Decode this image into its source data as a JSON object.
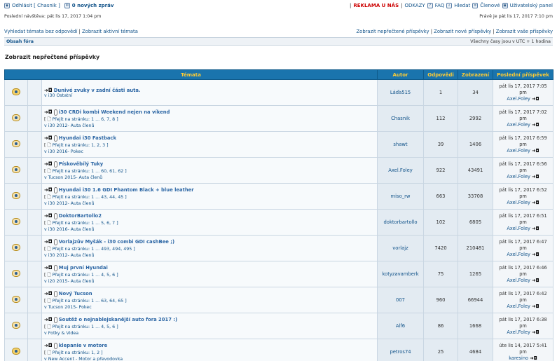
{
  "header": {
    "logout_label": "Odhlásit [ Chasnik ]",
    "messages_label": "0 nových zpráv",
    "reklama_label": "REKLAMA U NÁS",
    "sep": "|",
    "sep2": "|",
    "odkazy_label": "ODKAZY",
    "faq_label": "FAQ",
    "search_label": "Hledat",
    "members_label": "Členové",
    "panel_label": "Uživatelský panel",
    "last_visit": "Poslední návštěva: pát lis 17, 2017 1:04 pm",
    "now": "Právě je pát lis 17, 2017 7:10 pm"
  },
  "links": {
    "unanswered": "Vyhledat témata bez odpovědí",
    "active": "Zobrazit aktivní témata",
    "divider": "|",
    "unread": "Zobrazit nepřečtené příspěvky",
    "new": "Zobrazit nové příspěvky",
    "yours": "Zobrazit vaše příspěvky",
    "divider2": "|",
    "divider3": "|"
  },
  "nav": {
    "crumb": "Obsah fóra",
    "timezone": "Všechny časy jsou v UTC + 1 hodina"
  },
  "page_title": "Zobrazit nepřečtené příspěvky",
  "table": {
    "headers": [
      "Témata",
      "Autor",
      "Odpovědi",
      "Zobrazení",
      "Poslední příspěvek"
    ],
    "rows": [
      {
        "title": "Dunivé zvuky v zadní části auta.",
        "pages": "",
        "forum": "v i30 Ostatní",
        "author": "Láďa515",
        "replies": "1",
        "views": "34",
        "last_date": "pát lis 17, 2017 7:05",
        "last_time": "pm",
        "last_user": "Axel.Foley"
      },
      {
        "title": "i30 CRDi kombi Weekend nejen na víkend",
        "pages": "Přejít na stránku: 1 ... 6, 7, 8 ]",
        "forum": "v i30 2012- Auta členů",
        "author": "Chasnik",
        "replies": "112",
        "views": "2992",
        "last_date": "pát lis 17, 2017 7:02",
        "last_time": "pm",
        "last_user": "Axel.Foley"
      },
      {
        "title": "Hyundai i30 Fastback",
        "pages": "Přejít na stránku: 1, 2, 3 ]",
        "forum": "v i30 2016- Pokec",
        "author": "shawt",
        "replies": "39",
        "views": "1406",
        "last_date": "pát lis 17, 2017 6:59",
        "last_time": "pm",
        "last_user": "Axel.Foley"
      },
      {
        "title": "Pískověbílý Tuky",
        "pages": "Přejít na stránku: 1 ... 60, 61, 62 ]",
        "forum": "v Tucson 2015- Auta členů",
        "author": "Axel.Foley",
        "replies": "922",
        "views": "43491",
        "last_date": "pát lis 17, 2017 6:56",
        "last_time": "pm",
        "last_user": "Axel.Foley"
      },
      {
        "title": "Hyundai i30 1.6 GDI Phantom Black + blue leather",
        "pages": "Přejít na stránku: 1 ... 43, 44, 45 ]",
        "forum": "v i30 2012- Auta členů",
        "author": "miso_rw",
        "replies": "663",
        "views": "33708",
        "last_date": "pát lis 17, 2017 6:52",
        "last_time": "pm",
        "last_user": "Axel.Foley"
      },
      {
        "title": "DoktorBartollo2",
        "pages": "Přejít na stránku: 1 ... 5, 6, 7 ]",
        "forum": "v i30 2016- Auta členů",
        "author": "doktorbartollo",
        "replies": "102",
        "views": "6805",
        "last_date": "pát lis 17, 2017 6:51",
        "last_time": "pm",
        "last_user": "Axel.Foley"
      },
      {
        "title": "Vorlajzův Myšák - i30 combi GDI cashBee ;)",
        "pages": "Přejít na stránku: 1 ... 493, 494, 495 ]",
        "forum": "v i30 2012- Auta členů",
        "author": "vorlajz",
        "replies": "7420",
        "views": "210481",
        "last_date": "pát lis 17, 2017 6:47",
        "last_time": "pm",
        "last_user": "Axel.Foley"
      },
      {
        "title": "Muj první Hyundai",
        "pages": "Přejít na stránku: 1 ... 4, 5, 6 ]",
        "forum": "v i20 2015- Auta členů",
        "author": "kotyzavamberk",
        "replies": "75",
        "views": "1265",
        "last_date": "pát lis 17, 2017 6:46",
        "last_time": "pm",
        "last_user": "Axel.Foley"
      },
      {
        "title": "Nový Tucson",
        "pages": "Přejít na stránku: 1 ... 63, 64, 65 ]",
        "forum": "v Tucson 2015- Pokec",
        "author": "007",
        "replies": "960",
        "views": "66944",
        "last_date": "pát lis 17, 2017 6:42",
        "last_time": "pm",
        "last_user": "Axel.Foley"
      },
      {
        "title": "Soutěž o nejnablejskanější auto fora 2017 :)",
        "pages": "Přejít na stránku: 1 ... 4, 5, 6 ]",
        "forum": "v Fotky & Videa",
        "author": "Alf6",
        "replies": "86",
        "views": "1668",
        "last_date": "pát lis 17, 2017 6:38",
        "last_time": "pm",
        "last_user": "Axel.Foley"
      },
      {
        "title": "klepanie v motore",
        "pages": "Přejít na stránku: 1, 2 ]",
        "forum": "v New Accent - Motor a převodovka",
        "author": "petros74",
        "replies": "25",
        "views": "4684",
        "last_date": "úte lis 14, 2017 5:41",
        "last_time": "pm",
        "last_user": "karesino"
      }
    ]
  },
  "icons": {
    "user": "user-icon",
    "mail": "mail-icon",
    "faq": "faq-icon",
    "search": "search-icon",
    "members": "members-icon",
    "panel": "panel-icon"
  }
}
